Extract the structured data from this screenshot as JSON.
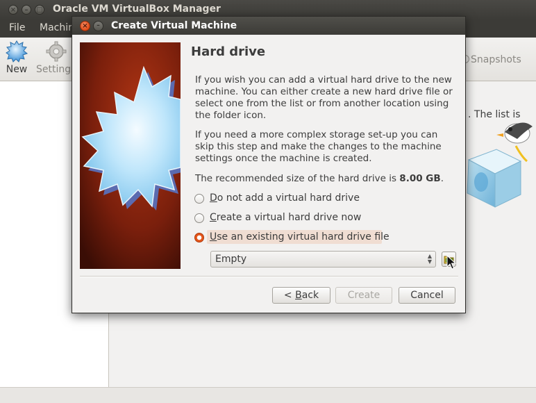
{
  "main_window": {
    "title": "Oracle VM VirtualBox Manager",
    "menu": {
      "file": "File",
      "machine": "Machine"
    },
    "toolbar": {
      "new": "New",
      "settings": "Settings",
      "snapshots": "Snapshots"
    },
    "welcome_fragment": ". The list is"
  },
  "dialog": {
    "title": "Create Virtual Machine",
    "page_title": "Hard drive",
    "paragraph1": "If you wish you can add a virtual hard drive to the new machine. You can either create a new hard drive file or select one from the list or from another location using the folder icon.",
    "paragraph2": "If you need a more complex storage set-up you can skip this step and make the changes to the machine settings once the machine is created.",
    "recommended_prefix": "The recommended size of the hard drive is ",
    "recommended_size": "8.00 GB",
    "recommended_suffix": ".",
    "options": [
      {
        "label_first": "D",
        "label_rest": "o not add a virtual hard drive",
        "checked": false
      },
      {
        "label_first": "C",
        "label_rest": "reate a virtual hard drive now",
        "checked": false
      },
      {
        "label_first": "U",
        "label_rest": "se an existing virtual hard drive file",
        "checked": true
      }
    ],
    "combo_value": "Empty",
    "buttons": {
      "back_prefix": "< ",
      "back_first": "B",
      "back_rest": "ack",
      "create": "Create",
      "cancel": "Cancel"
    }
  },
  "colors": {
    "titlebar": "#3c3b37",
    "accent_orange": "#e4561b",
    "wizard_background": "#7a1f0c",
    "selection_highlight": "#f0ddd2"
  }
}
